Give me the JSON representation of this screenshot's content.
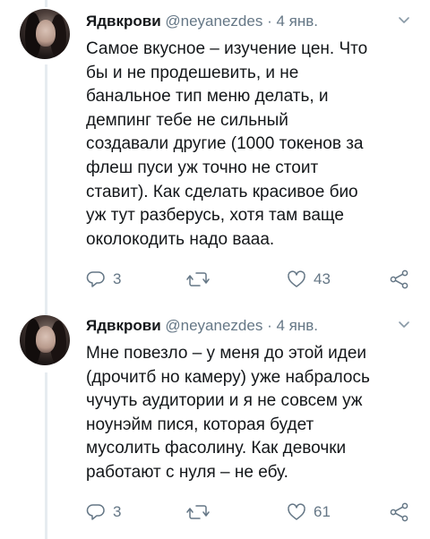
{
  "tweets": [
    {
      "name": "Ядвкрови",
      "handle": "@neyanezdes",
      "separator": "·",
      "date": "4 янв.",
      "text": "Самое вкусное – изучение цен. Что\nбы и не продешевить, и не\nбанальное тип меню делать, и\nдемпинг тебе не сильный\nсоздавали другие (1000 токенов за\nфлеш пуси уж точно не стоит\nставит). Как сделать красивое био\nуж тут разберусь, хотя там ваще\nоколокодить надо ваaa.",
      "replies": "3",
      "retweets": "",
      "likes": "43"
    },
    {
      "name": "Ядвкрови",
      "handle": "@neyanezdes",
      "separator": "·",
      "date": "4 янв.",
      "text": "Мне повезло – у меня до этой идеи\n(дрочитб но камеру) уже набралось\nчучуть аудитории и я не совсем уж\nноунэйм пися, которая будет\nмусолить фасолину. Как девочки\nработают с нуля – не ебу.",
      "replies": "3",
      "retweets": "",
      "likes": "61"
    }
  ],
  "icons": {
    "reply": "reply-icon",
    "retweet": "retweet-icon",
    "like": "heart-icon",
    "share": "share-icon",
    "menu": "chevron-down-icon"
  },
  "colors": {
    "text": "#14171a",
    "secondary": "#657786",
    "thread_line": "#e6ecf0"
  }
}
